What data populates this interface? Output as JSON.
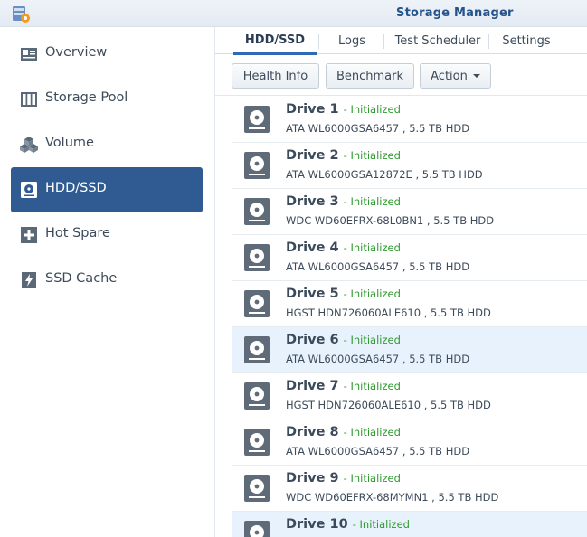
{
  "app": {
    "title": "Storage Manager"
  },
  "sidebar": {
    "items": [
      {
        "label": "Overview",
        "icon": "overview-icon"
      },
      {
        "label": "Storage Pool",
        "icon": "storage-pool-icon"
      },
      {
        "label": "Volume",
        "icon": "volume-icon"
      },
      {
        "label": "HDD/SSD",
        "icon": "hdd-icon",
        "active": true
      },
      {
        "label": "Hot Spare",
        "icon": "hot-spare-icon"
      },
      {
        "label": "SSD Cache",
        "icon": "ssd-cache-icon"
      }
    ]
  },
  "tabs": [
    {
      "label": "HDD/SSD",
      "active": true
    },
    {
      "label": "Logs"
    },
    {
      "label": "Test Scheduler"
    },
    {
      "label": "Settings"
    }
  ],
  "toolbar": {
    "health_info": "Health Info",
    "benchmark": "Benchmark",
    "action": "Action"
  },
  "drives": [
    {
      "name": "Drive 1",
      "status": "- Initialized",
      "desc": "ATA WL6000GSA6457 , 5.5 TB HDD"
    },
    {
      "name": "Drive 2",
      "status": "- Initialized",
      "desc": "ATA WL6000GSA12872E , 5.5 TB HDD"
    },
    {
      "name": "Drive 3",
      "status": "- Initialized",
      "desc": "WDC WD60EFRX-68L0BN1 , 5.5 TB HDD"
    },
    {
      "name": "Drive 4",
      "status": "- Initialized",
      "desc": "ATA WL6000GSA6457 , 5.5 TB HDD"
    },
    {
      "name": "Drive 5",
      "status": "- Initialized",
      "desc": "HGST HDN726060ALE610 , 5.5 TB HDD"
    },
    {
      "name": "Drive 6",
      "status": "- Initialized",
      "desc": "ATA WL6000GSA6457 , 5.5 TB HDD"
    },
    {
      "name": "Drive 7",
      "status": "- Initialized",
      "desc": "HGST HDN726060ALE610 , 5.5 TB HDD"
    },
    {
      "name": "Drive 8",
      "status": "- Initialized",
      "desc": "ATA WL6000GSA6457 , 5.5 TB HDD"
    },
    {
      "name": "Drive 9",
      "status": "- Initialized",
      "desc": "WDC WD60EFRX-68MYMN1 , 5.5 TB HDD"
    },
    {
      "name": "Drive 10",
      "status": "- Initialized",
      "desc": ""
    }
  ],
  "colors": {
    "accent": "#2f5b92",
    "initialized": "#2f9a2f",
    "row_highlight": "#e8f2fc"
  }
}
